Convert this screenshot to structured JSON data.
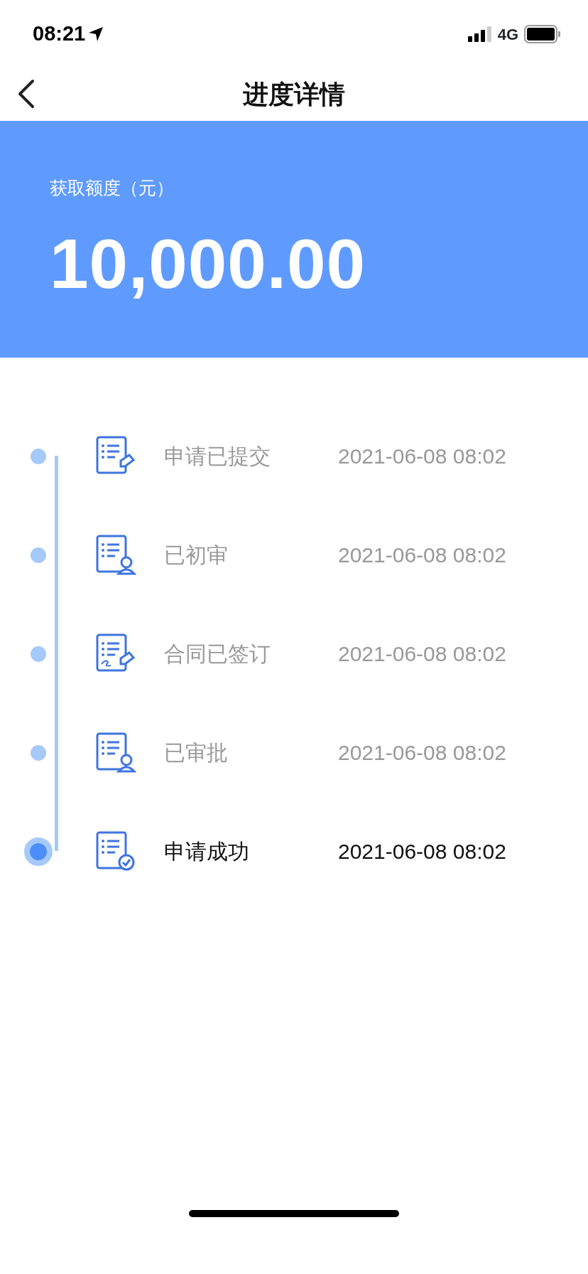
{
  "status_bar": {
    "time": "08:21",
    "network": "4G"
  },
  "nav": {
    "title": "进度详情"
  },
  "banner": {
    "label": "获取额度（元）",
    "amount": "10,000.00"
  },
  "steps": [
    {
      "kind": "pen",
      "label": "申请已提交",
      "time": "2021-06-08 08:02",
      "current": false
    },
    {
      "kind": "person",
      "label": "已初审",
      "time": "2021-06-08 08:02",
      "current": false
    },
    {
      "kind": "sign",
      "label": "合同已签订",
      "time": "2021-06-08 08:02",
      "current": false
    },
    {
      "kind": "person",
      "label": "已审批",
      "time": "2021-06-08 08:02",
      "current": false
    },
    {
      "kind": "check",
      "label": "申请成功",
      "time": "2021-06-08 08:02",
      "current": true
    }
  ]
}
